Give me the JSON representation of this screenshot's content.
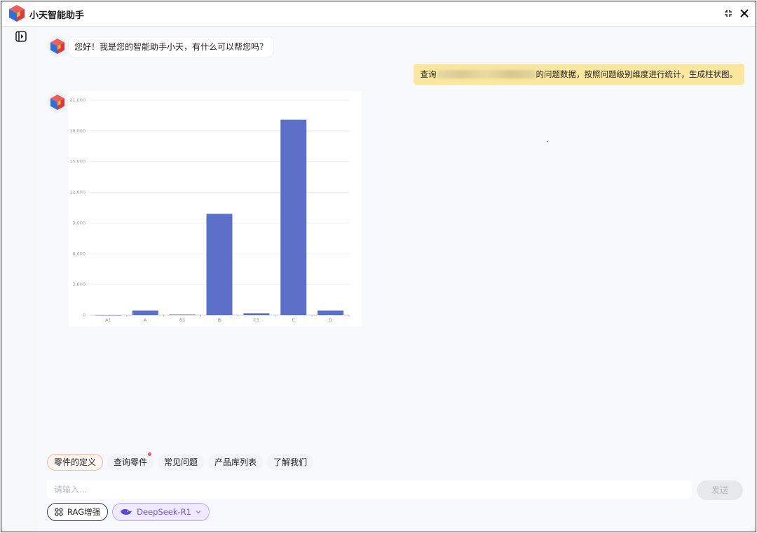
{
  "app": {
    "title": "小天智能助手"
  },
  "chat": {
    "greeting": "您好！我是您的智能助手小天，有什么可以帮您吗？",
    "user_query_prefix": "查询",
    "user_query_suffix": "的问题数据，按照问题级别维度进行统计，生成柱状图。"
  },
  "chart_data": {
    "type": "bar",
    "categories": [
      "A1",
      "A",
      "B1",
      "B",
      "C1",
      "C",
      "D"
    ],
    "values": [
      0,
      450,
      60,
      9900,
      180,
      19100,
      450
    ],
    "ylim": [
      0,
      21000
    ],
    "yticks": [
      "0",
      "3,000",
      "6,000",
      "9,000",
      "12,000",
      "15,000",
      "18,000",
      "21,000"
    ],
    "grid": true,
    "bar_color": "#5c70c9"
  },
  "quick_actions": [
    {
      "label": "零件的定义",
      "active": true,
      "badge": false
    },
    {
      "label": "查询零件",
      "active": false,
      "badge": true
    },
    {
      "label": "常见问题",
      "active": false,
      "badge": false
    },
    {
      "label": "产品库列表",
      "active": false,
      "badge": false
    },
    {
      "label": "了解我们",
      "active": false,
      "badge": false
    }
  ],
  "input": {
    "placeholder": "请输入...",
    "send_label": "发送"
  },
  "tools": {
    "rag_label": "RAG增强",
    "model_label": "DeepSeek-R1"
  },
  "colors": {
    "user_bubble": "#fbe7a0",
    "accent": "#5c70c9",
    "model_accent": "#6a55e0"
  }
}
